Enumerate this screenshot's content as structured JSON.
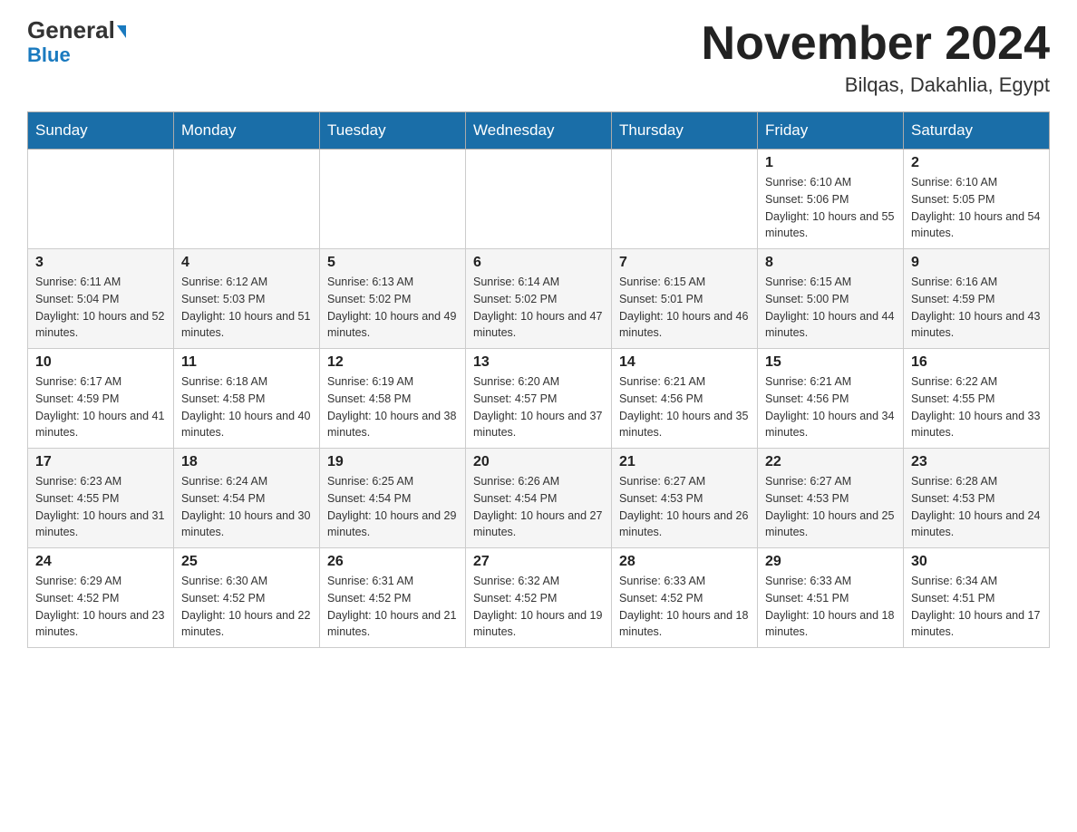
{
  "header": {
    "logo_general": "General",
    "logo_blue": "Blue",
    "month_title": "November 2024",
    "location": "Bilqas, Dakahlia, Egypt"
  },
  "days_of_week": [
    "Sunday",
    "Monday",
    "Tuesday",
    "Wednesday",
    "Thursday",
    "Friday",
    "Saturday"
  ],
  "weeks": [
    [
      {
        "day": "",
        "info": ""
      },
      {
        "day": "",
        "info": ""
      },
      {
        "day": "",
        "info": ""
      },
      {
        "day": "",
        "info": ""
      },
      {
        "day": "",
        "info": ""
      },
      {
        "day": "1",
        "info": "Sunrise: 6:10 AM\nSunset: 5:06 PM\nDaylight: 10 hours and 55 minutes."
      },
      {
        "day": "2",
        "info": "Sunrise: 6:10 AM\nSunset: 5:05 PM\nDaylight: 10 hours and 54 minutes."
      }
    ],
    [
      {
        "day": "3",
        "info": "Sunrise: 6:11 AM\nSunset: 5:04 PM\nDaylight: 10 hours and 52 minutes."
      },
      {
        "day": "4",
        "info": "Sunrise: 6:12 AM\nSunset: 5:03 PM\nDaylight: 10 hours and 51 minutes."
      },
      {
        "day": "5",
        "info": "Sunrise: 6:13 AM\nSunset: 5:02 PM\nDaylight: 10 hours and 49 minutes."
      },
      {
        "day": "6",
        "info": "Sunrise: 6:14 AM\nSunset: 5:02 PM\nDaylight: 10 hours and 47 minutes."
      },
      {
        "day": "7",
        "info": "Sunrise: 6:15 AM\nSunset: 5:01 PM\nDaylight: 10 hours and 46 minutes."
      },
      {
        "day": "8",
        "info": "Sunrise: 6:15 AM\nSunset: 5:00 PM\nDaylight: 10 hours and 44 minutes."
      },
      {
        "day": "9",
        "info": "Sunrise: 6:16 AM\nSunset: 4:59 PM\nDaylight: 10 hours and 43 minutes."
      }
    ],
    [
      {
        "day": "10",
        "info": "Sunrise: 6:17 AM\nSunset: 4:59 PM\nDaylight: 10 hours and 41 minutes."
      },
      {
        "day": "11",
        "info": "Sunrise: 6:18 AM\nSunset: 4:58 PM\nDaylight: 10 hours and 40 minutes."
      },
      {
        "day": "12",
        "info": "Sunrise: 6:19 AM\nSunset: 4:58 PM\nDaylight: 10 hours and 38 minutes."
      },
      {
        "day": "13",
        "info": "Sunrise: 6:20 AM\nSunset: 4:57 PM\nDaylight: 10 hours and 37 minutes."
      },
      {
        "day": "14",
        "info": "Sunrise: 6:21 AM\nSunset: 4:56 PM\nDaylight: 10 hours and 35 minutes."
      },
      {
        "day": "15",
        "info": "Sunrise: 6:21 AM\nSunset: 4:56 PM\nDaylight: 10 hours and 34 minutes."
      },
      {
        "day": "16",
        "info": "Sunrise: 6:22 AM\nSunset: 4:55 PM\nDaylight: 10 hours and 33 minutes."
      }
    ],
    [
      {
        "day": "17",
        "info": "Sunrise: 6:23 AM\nSunset: 4:55 PM\nDaylight: 10 hours and 31 minutes."
      },
      {
        "day": "18",
        "info": "Sunrise: 6:24 AM\nSunset: 4:54 PM\nDaylight: 10 hours and 30 minutes."
      },
      {
        "day": "19",
        "info": "Sunrise: 6:25 AM\nSunset: 4:54 PM\nDaylight: 10 hours and 29 minutes."
      },
      {
        "day": "20",
        "info": "Sunrise: 6:26 AM\nSunset: 4:54 PM\nDaylight: 10 hours and 27 minutes."
      },
      {
        "day": "21",
        "info": "Sunrise: 6:27 AM\nSunset: 4:53 PM\nDaylight: 10 hours and 26 minutes."
      },
      {
        "day": "22",
        "info": "Sunrise: 6:27 AM\nSunset: 4:53 PM\nDaylight: 10 hours and 25 minutes."
      },
      {
        "day": "23",
        "info": "Sunrise: 6:28 AM\nSunset: 4:53 PM\nDaylight: 10 hours and 24 minutes."
      }
    ],
    [
      {
        "day": "24",
        "info": "Sunrise: 6:29 AM\nSunset: 4:52 PM\nDaylight: 10 hours and 23 minutes."
      },
      {
        "day": "25",
        "info": "Sunrise: 6:30 AM\nSunset: 4:52 PM\nDaylight: 10 hours and 22 minutes."
      },
      {
        "day": "26",
        "info": "Sunrise: 6:31 AM\nSunset: 4:52 PM\nDaylight: 10 hours and 21 minutes."
      },
      {
        "day": "27",
        "info": "Sunrise: 6:32 AM\nSunset: 4:52 PM\nDaylight: 10 hours and 19 minutes."
      },
      {
        "day": "28",
        "info": "Sunrise: 6:33 AM\nSunset: 4:52 PM\nDaylight: 10 hours and 18 minutes."
      },
      {
        "day": "29",
        "info": "Sunrise: 6:33 AM\nSunset: 4:51 PM\nDaylight: 10 hours and 18 minutes."
      },
      {
        "day": "30",
        "info": "Sunrise: 6:34 AM\nSunset: 4:51 PM\nDaylight: 10 hours and 17 minutes."
      }
    ]
  ]
}
